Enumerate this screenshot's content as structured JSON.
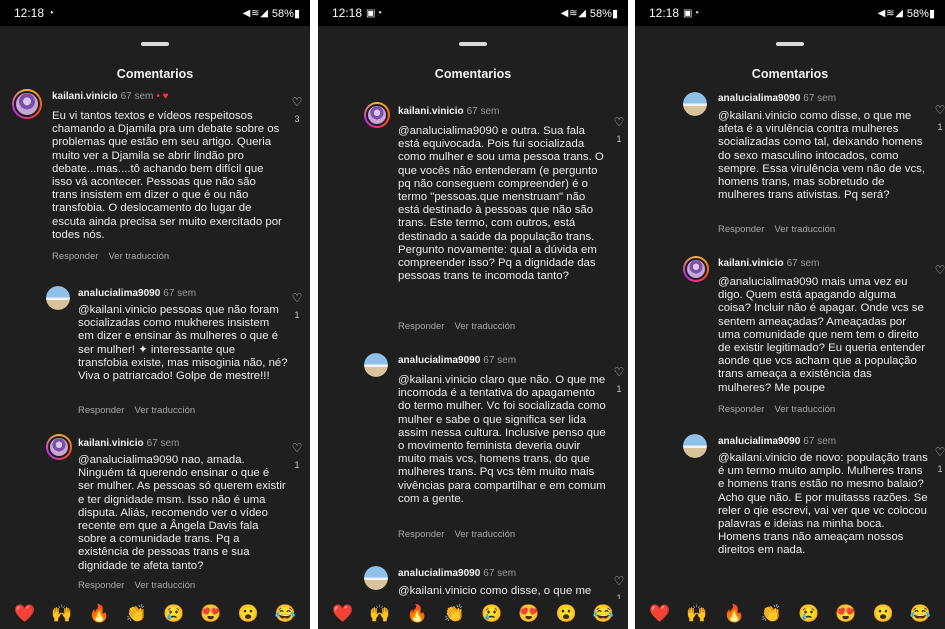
{
  "panels": [
    {
      "status": {
        "time": "12:18",
        "icons": "◔",
        "signal": "◀ ≋ ◢",
        "battery": "58%▮"
      },
      "title": "Comentarios",
      "comments": [
        {
          "user": "kailani.vinicio",
          "time": "67 sem",
          "liked": "• ♥",
          "like_count": "3",
          "text": "Eu vi tantos textos e vídeos respeitosos chamando a Djamila pra um debate sobre os problemas que estão em seu artigo. Queria muito ver a Djamila se abrir lindão pro debate...mas....tô achando bem difícil que isso vá acontecer. Pessoas que não são trans insistem em dizer o que é ou não transfobia. O deslocamento do lugar de escuta ainda precisa ser muito exercitado por todes nós."
        },
        {
          "user": "analucialima9090",
          "time": "67 sem",
          "like_count": "1",
          "text": "@kailani.vinicio pessoas que não foram socializadas como mukheres insistem em dizer e ensinar às mulheres o que é ser mulher! ✦ interessante que transfobia existe, mas misoginia não, né? Viva o patriarcado! Golpe de mestre!!!"
        },
        {
          "user": "kailani.vinicio",
          "time": "67 sem",
          "like_count": "1",
          "text": "@analucialima9090 nao, amada. Ninguém tá querendo ensinar o que é ser mulher. As pessoas só querem existir e ter dignidade msm. Isso não é uma disputa. Aliás, recomendo ver o vídeo recente em que a Ângela Davis fala sobre a comunidade trans. Pq a existência de pessoas trans e sua dignidade te afeta tanto?"
        }
      ]
    },
    {
      "status": {
        "time": "12:18",
        "icons": "▣ ◔",
        "signal": "◀ ≋ ◢",
        "battery": "58%▮"
      },
      "title": "Comentarios",
      "comments": [
        {
          "user": "kailani.vinicio",
          "time": "67 sem",
          "like_count": "1",
          "text": "@analucialima9090 e outra. Sua fala está equivocada. Pois fui socializada como mulher e sou uma pessoa trans. O que vocês não entenderam (e pergunto pq não conseguem compreender) é o termo \"pessoas.que menstruam\" não está destinado à pessoas que não são trans. Este termo, com outros, está destinado a saúde da população trans. Pergunto novamente: qual a dúvida em compreender isso? Pq a dignidade das pessoas trans te incomoda tanto?"
        },
        {
          "user": "analucialima9090",
          "time": "67 sem",
          "like_count": "1",
          "text": "@kailani.vinicio claro que não. O que me incomoda é a tentativa do apagamento do termo mulher. Vc foi socializada como mulher e sabe o que significa ser lida assim nessa cultura. Inclusive penso que o movimento feminista deveria ouvir muito mais vcs, homens trans, do que mulheres trans. Pq vcs têm muito mais vivências para compartilhar e em comum com a gente."
        },
        {
          "user": "analucialima9090",
          "time": "67 sem",
          "like_count": "1",
          "text": "@kailani.vinicio como disse, o que me afeta é a virulência contra mulheres"
        }
      ]
    },
    {
      "status": {
        "time": "12:18",
        "icons": "▣ ◔",
        "signal": "◀ ≋ ◢",
        "battery": "58%▮"
      },
      "title": "Comentarios",
      "comments": [
        {
          "user": "analucialima9090",
          "time": "67 sem",
          "like_count": "1",
          "text": "@kailani.vinicio como disse, o que me afeta é a virulência contra mulheres socializadas como tal, deixando homens do sexo masculino intocados, como sempre. Essa virulência vem não de vcs, homens trans, mas sobretudo de mulheres trans ativistas. Pq será?"
        },
        {
          "user": "kailani.vinicio",
          "time": "67 sem",
          "like_count": "",
          "text": "@analucialima9090 mais uma vez eu digo. Quem está apagando alguma coisa? Incluir não é apagar. Onde vcs se sentem ameaçadas? Ameaçadas por uma comunidade que nem tem o direito de existir legitimado? Eu queria entender aonde que vcs acham que a população trans ameaça a existência das mulheres? Me poupe"
        },
        {
          "user": "analucialima9090",
          "time": "67 sem",
          "like_count": "1",
          "text": "@kailani.vinicio de novo: população trans é um termo muito amplo. Mulheres trans e homens trans estão no mesmo balaio? Acho que não. E por muitasss razões. Se reler o qie escrevi, vai ver que vc colocou palavras e ideias na minha boca. Homens trans não ameaçam nossos direitos em nada."
        }
      ]
    }
  ],
  "actions": {
    "reply": "Responder",
    "translate": "Ver traducción"
  },
  "reactions": [
    "❤️",
    "🙌",
    "🔥",
    "👏",
    "😢",
    "😍",
    "😮",
    "😂"
  ],
  "colors": {
    "background": "#1f1f1f",
    "text": "#ececec",
    "muted": "#a8a8a8",
    "like": "#ff3040"
  }
}
